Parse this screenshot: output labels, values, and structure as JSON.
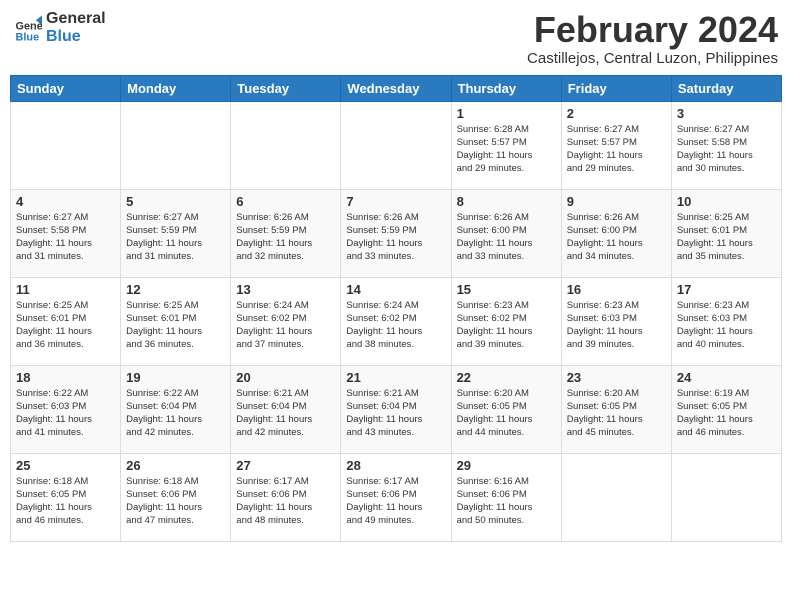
{
  "logo": {
    "text_general": "General",
    "text_blue": "Blue"
  },
  "title": "February 2024",
  "subtitle": "Castillejos, Central Luzon, Philippines",
  "weekdays": [
    "Sunday",
    "Monday",
    "Tuesday",
    "Wednesday",
    "Thursday",
    "Friday",
    "Saturday"
  ],
  "weeks": [
    [
      {
        "day": "",
        "info": ""
      },
      {
        "day": "",
        "info": ""
      },
      {
        "day": "",
        "info": ""
      },
      {
        "day": "",
        "info": ""
      },
      {
        "day": "1",
        "info": "Sunrise: 6:28 AM\nSunset: 5:57 PM\nDaylight: 11 hours\nand 29 minutes."
      },
      {
        "day": "2",
        "info": "Sunrise: 6:27 AM\nSunset: 5:57 PM\nDaylight: 11 hours\nand 29 minutes."
      },
      {
        "day": "3",
        "info": "Sunrise: 6:27 AM\nSunset: 5:58 PM\nDaylight: 11 hours\nand 30 minutes."
      }
    ],
    [
      {
        "day": "4",
        "info": "Sunrise: 6:27 AM\nSunset: 5:58 PM\nDaylight: 11 hours\nand 31 minutes."
      },
      {
        "day": "5",
        "info": "Sunrise: 6:27 AM\nSunset: 5:59 PM\nDaylight: 11 hours\nand 31 minutes."
      },
      {
        "day": "6",
        "info": "Sunrise: 6:26 AM\nSunset: 5:59 PM\nDaylight: 11 hours\nand 32 minutes."
      },
      {
        "day": "7",
        "info": "Sunrise: 6:26 AM\nSunset: 5:59 PM\nDaylight: 11 hours\nand 33 minutes."
      },
      {
        "day": "8",
        "info": "Sunrise: 6:26 AM\nSunset: 6:00 PM\nDaylight: 11 hours\nand 33 minutes."
      },
      {
        "day": "9",
        "info": "Sunrise: 6:26 AM\nSunset: 6:00 PM\nDaylight: 11 hours\nand 34 minutes."
      },
      {
        "day": "10",
        "info": "Sunrise: 6:25 AM\nSunset: 6:01 PM\nDaylight: 11 hours\nand 35 minutes."
      }
    ],
    [
      {
        "day": "11",
        "info": "Sunrise: 6:25 AM\nSunset: 6:01 PM\nDaylight: 11 hours\nand 36 minutes."
      },
      {
        "day": "12",
        "info": "Sunrise: 6:25 AM\nSunset: 6:01 PM\nDaylight: 11 hours\nand 36 minutes."
      },
      {
        "day": "13",
        "info": "Sunrise: 6:24 AM\nSunset: 6:02 PM\nDaylight: 11 hours\nand 37 minutes."
      },
      {
        "day": "14",
        "info": "Sunrise: 6:24 AM\nSunset: 6:02 PM\nDaylight: 11 hours\nand 38 minutes."
      },
      {
        "day": "15",
        "info": "Sunrise: 6:23 AM\nSunset: 6:02 PM\nDaylight: 11 hours\nand 39 minutes."
      },
      {
        "day": "16",
        "info": "Sunrise: 6:23 AM\nSunset: 6:03 PM\nDaylight: 11 hours\nand 39 minutes."
      },
      {
        "day": "17",
        "info": "Sunrise: 6:23 AM\nSunset: 6:03 PM\nDaylight: 11 hours\nand 40 minutes."
      }
    ],
    [
      {
        "day": "18",
        "info": "Sunrise: 6:22 AM\nSunset: 6:03 PM\nDaylight: 11 hours\nand 41 minutes."
      },
      {
        "day": "19",
        "info": "Sunrise: 6:22 AM\nSunset: 6:04 PM\nDaylight: 11 hours\nand 42 minutes."
      },
      {
        "day": "20",
        "info": "Sunrise: 6:21 AM\nSunset: 6:04 PM\nDaylight: 11 hours\nand 42 minutes."
      },
      {
        "day": "21",
        "info": "Sunrise: 6:21 AM\nSunset: 6:04 PM\nDaylight: 11 hours\nand 43 minutes."
      },
      {
        "day": "22",
        "info": "Sunrise: 6:20 AM\nSunset: 6:05 PM\nDaylight: 11 hours\nand 44 minutes."
      },
      {
        "day": "23",
        "info": "Sunrise: 6:20 AM\nSunset: 6:05 PM\nDaylight: 11 hours\nand 45 minutes."
      },
      {
        "day": "24",
        "info": "Sunrise: 6:19 AM\nSunset: 6:05 PM\nDaylight: 11 hours\nand 46 minutes."
      }
    ],
    [
      {
        "day": "25",
        "info": "Sunrise: 6:18 AM\nSunset: 6:05 PM\nDaylight: 11 hours\nand 46 minutes."
      },
      {
        "day": "26",
        "info": "Sunrise: 6:18 AM\nSunset: 6:06 PM\nDaylight: 11 hours\nand 47 minutes."
      },
      {
        "day": "27",
        "info": "Sunrise: 6:17 AM\nSunset: 6:06 PM\nDaylight: 11 hours\nand 48 minutes."
      },
      {
        "day": "28",
        "info": "Sunrise: 6:17 AM\nSunset: 6:06 PM\nDaylight: 11 hours\nand 49 minutes."
      },
      {
        "day": "29",
        "info": "Sunrise: 6:16 AM\nSunset: 6:06 PM\nDaylight: 11 hours\nand 50 minutes."
      },
      {
        "day": "",
        "info": ""
      },
      {
        "day": "",
        "info": ""
      }
    ]
  ]
}
